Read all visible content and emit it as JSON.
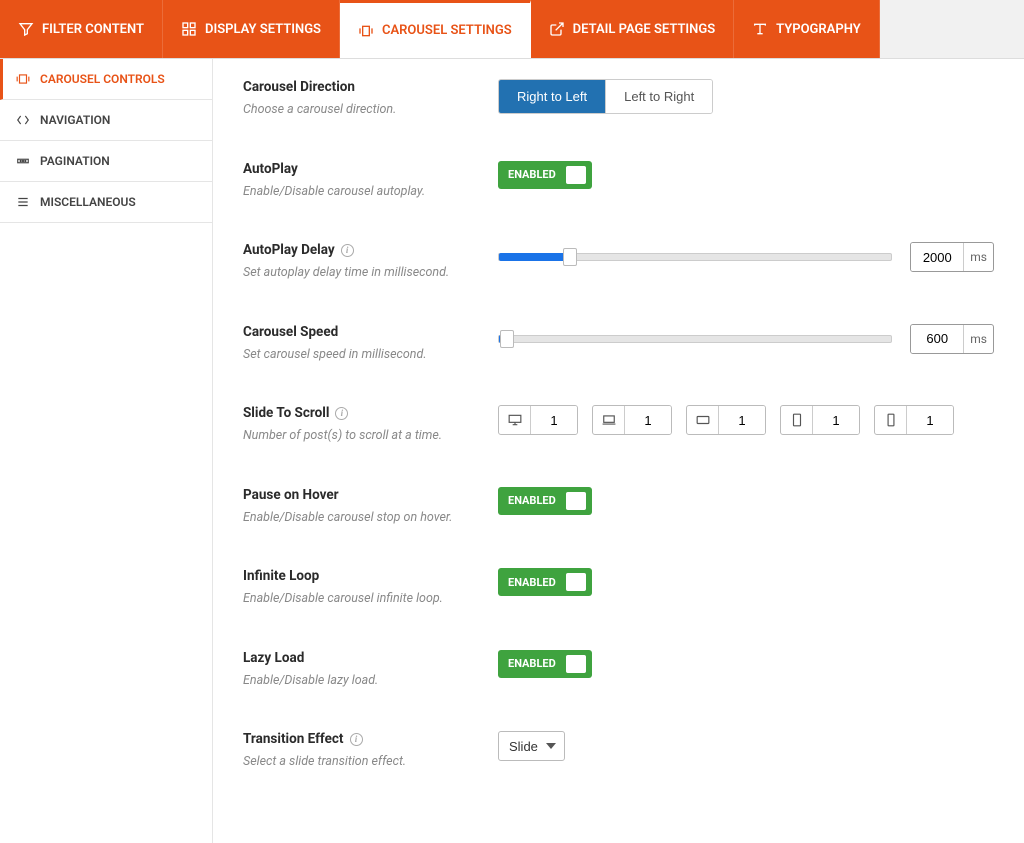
{
  "tabs": [
    {
      "label": "FILTER CONTENT"
    },
    {
      "label": "DISPLAY SETTINGS"
    },
    {
      "label": "CAROUSEL SETTINGS"
    },
    {
      "label": "DETAIL PAGE SETTINGS"
    },
    {
      "label": "TYPOGRAPHY"
    }
  ],
  "active_tab": "CAROUSEL SETTINGS",
  "sidebar": [
    {
      "label": "CAROUSEL CONTROLS"
    },
    {
      "label": "NAVIGATION"
    },
    {
      "label": "PAGINATION"
    },
    {
      "label": "MISCELLANEOUS"
    }
  ],
  "fields": {
    "direction": {
      "title": "Carousel Direction",
      "desc": "Choose a carousel direction.",
      "option_a": "Right to Left",
      "option_b": "Left to Right",
      "selected": "Right to Left"
    },
    "autoplay": {
      "title": "AutoPlay",
      "desc": "Enable/Disable carousel autoplay.",
      "state": "ENABLED"
    },
    "autoplay_delay": {
      "title": "AutoPlay Delay",
      "desc": "Set autoplay delay time in millisecond.",
      "value": "2000",
      "unit": "ms",
      "fill_pct": 18
    },
    "speed": {
      "title": "Carousel Speed",
      "desc": "Set carousel speed in millisecond.",
      "value": "600",
      "unit": "ms",
      "fill_pct": 2
    },
    "slide_to_scroll": {
      "title": "Slide To Scroll",
      "desc": "Number of post(s) to scroll at a time.",
      "values": [
        "1",
        "1",
        "1",
        "1",
        "1"
      ]
    },
    "pause_on_hover": {
      "title": "Pause on Hover",
      "desc": "Enable/Disable carousel stop on hover.",
      "state": "ENABLED"
    },
    "infinite_loop": {
      "title": "Infinite Loop",
      "desc": "Enable/Disable carousel infinite loop.",
      "state": "ENABLED"
    },
    "lazy_load": {
      "title": "Lazy Load",
      "desc": "Enable/Disable lazy load.",
      "state": "ENABLED"
    },
    "transition": {
      "title": "Transition Effect",
      "desc": "Select a slide transition effect.",
      "value": "Slide"
    }
  }
}
